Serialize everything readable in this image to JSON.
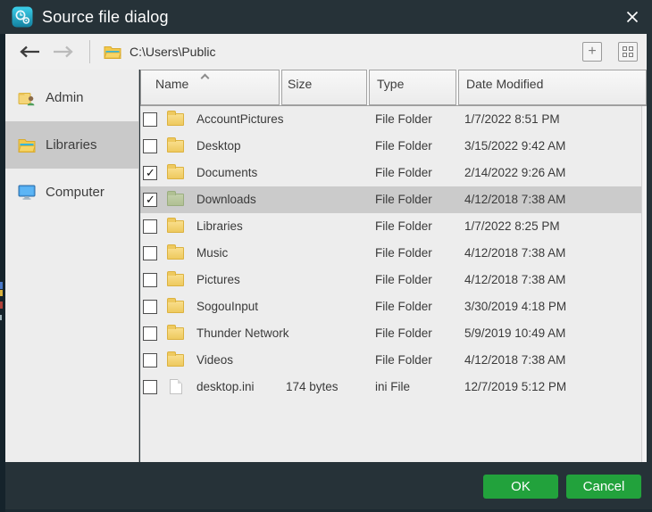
{
  "window": {
    "title": "Source file dialog",
    "close_icon": "✕"
  },
  "navbar": {
    "back_icon": "back-arrow",
    "forward_icon": "forward-arrow",
    "address_icon": "folder-icon",
    "path": "C:\\Users\\Public",
    "add_button_icon": "+",
    "view_button_icon": "grid"
  },
  "sidebar": {
    "items": [
      {
        "label": "Admin",
        "icon": "user-folder-icon",
        "selected": false
      },
      {
        "label": "Libraries",
        "icon": "libraries-folder-icon",
        "selected": true
      },
      {
        "label": "Computer",
        "icon": "computer-icon",
        "selected": false
      }
    ]
  },
  "table": {
    "columns": [
      {
        "label": "Name",
        "sort": "asc"
      },
      {
        "label": "Size",
        "sort": null
      },
      {
        "label": "Type",
        "sort": null
      },
      {
        "label": "Date Modified",
        "sort": null
      }
    ],
    "rows": [
      {
        "name": "AccountPictures",
        "icon": "folder",
        "checked": false,
        "selected": false,
        "size": "",
        "type": "File Folder",
        "date": "1/7/2022 8:51 PM"
      },
      {
        "name": "Desktop",
        "icon": "folder",
        "checked": false,
        "selected": false,
        "size": "",
        "type": "File Folder",
        "date": "3/15/2022 9:42 AM"
      },
      {
        "name": "Documents",
        "icon": "folder",
        "checked": true,
        "selected": false,
        "size": "",
        "type": "File Folder",
        "date": "2/14/2022 9:26 AM"
      },
      {
        "name": "Downloads",
        "icon": "folder-green",
        "checked": true,
        "selected": true,
        "size": "",
        "type": "File Folder",
        "date": "4/12/2018 7:38 AM"
      },
      {
        "name": "Libraries",
        "icon": "folder",
        "checked": false,
        "selected": false,
        "size": "",
        "type": "File Folder",
        "date": "1/7/2022 8:25 PM"
      },
      {
        "name": "Music",
        "icon": "folder",
        "checked": false,
        "selected": false,
        "size": "",
        "type": "File Folder",
        "date": "4/12/2018 7:38 AM"
      },
      {
        "name": "Pictures",
        "icon": "folder",
        "checked": false,
        "selected": false,
        "size": "",
        "type": "File Folder",
        "date": "4/12/2018 7:38 AM"
      },
      {
        "name": "SogouInput",
        "icon": "folder",
        "checked": false,
        "selected": false,
        "size": "",
        "type": "File Folder",
        "date": "3/30/2019 4:18 PM"
      },
      {
        "name": "Thunder Network",
        "icon": "folder",
        "checked": false,
        "selected": false,
        "size": "",
        "type": "File Folder",
        "date": "5/9/2019 10:49 AM"
      },
      {
        "name": "Videos",
        "icon": "folder",
        "checked": false,
        "selected": false,
        "size": "",
        "type": "File Folder",
        "date": "4/12/2018 7:38 AM"
      },
      {
        "name": "desktop.ini",
        "icon": "file",
        "checked": false,
        "selected": false,
        "size": "174 bytes",
        "type": "ini File",
        "date": "12/7/2019 5:12 PM"
      }
    ]
  },
  "footer": {
    "ok_label": "OK",
    "cancel_label": "Cancel"
  },
  "colors": {
    "titlebar": "#263238",
    "accent_green": "#22a23c",
    "selected_row": "#cbcbcb",
    "sidebar_selected": "#c9c9c9",
    "panel_gray": "#ededed",
    "app_icon_cyan": "#2bb5d6"
  }
}
